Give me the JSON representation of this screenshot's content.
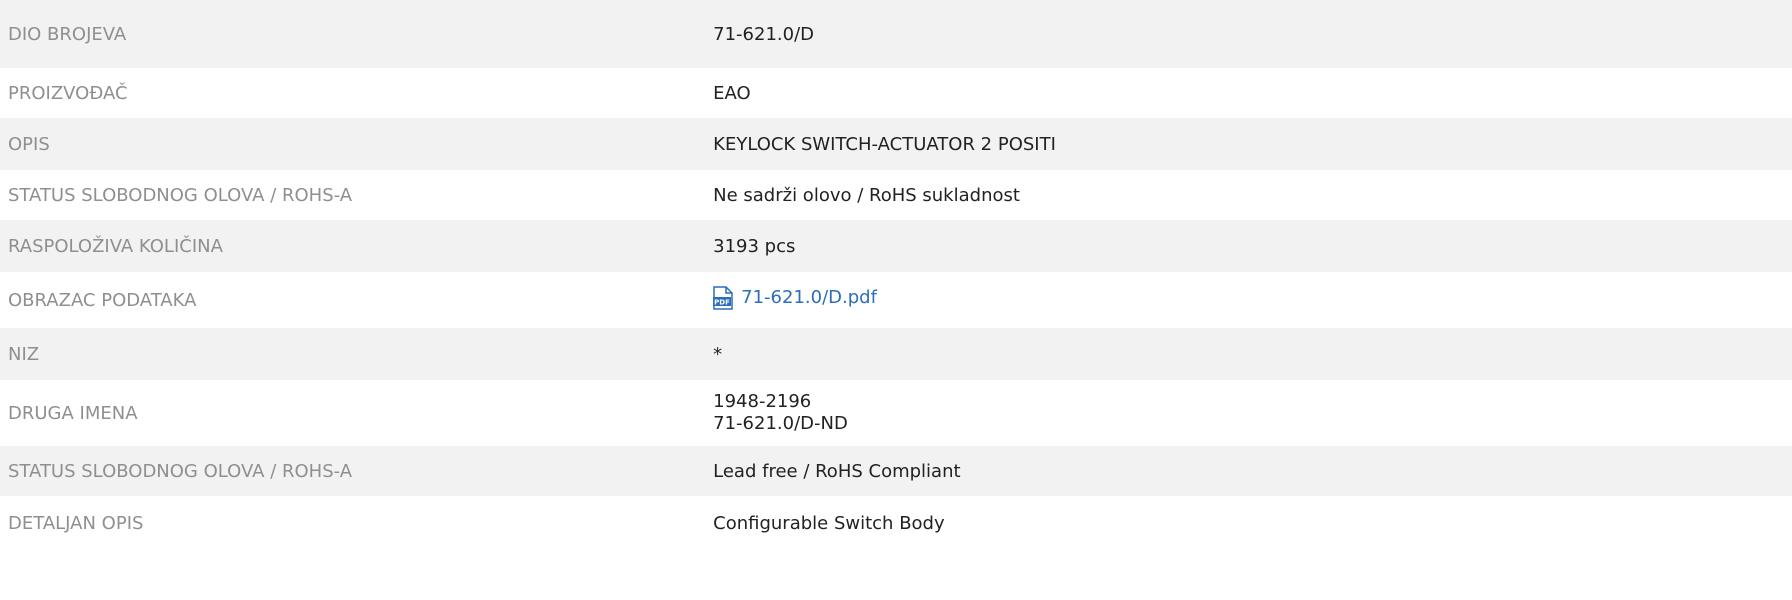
{
  "rows": [
    {
      "label": "DIO BROJEVA",
      "value": "71-621.0/D"
    },
    {
      "label": "PROIZVOĐAČ",
      "value": "EAO"
    },
    {
      "label": "OPIS",
      "value": "KEYLOCK SWITCH-ACTUATOR 2 POSITI"
    },
    {
      "label": "STATUS SLOBODNOG OLOVA / ROHS-A",
      "value": "Ne sadrži olovo / RoHS sukladnost"
    },
    {
      "label": "RASPOLOŽIVA KOLIČINA",
      "value": "3193 pcs"
    },
    {
      "label": "OBRAZAC PODATAKA",
      "value": "71-621.0/D.pdf",
      "icon": "pdf-file-icon",
      "link_color": "#2c6eb8"
    },
    {
      "label": "NIZ",
      "value": "*"
    },
    {
      "label": "DRUGA IMENA",
      "values": [
        "1948-2196",
        "71-621.0/D-ND"
      ]
    },
    {
      "label": "STATUS SLOBODNOG OLOVA / ROHS-A",
      "value": "Lead free / RoHS Compliant"
    },
    {
      "label": "DETALJAN OPIS",
      "value": "Configurable Switch Body"
    }
  ],
  "colors": {
    "stripe": "#f2f2f2",
    "label_text": "#8f8f8f",
    "value_text": "#222222",
    "link": "#2c6eb8",
    "pdf_icon": "#2c6eb8"
  }
}
